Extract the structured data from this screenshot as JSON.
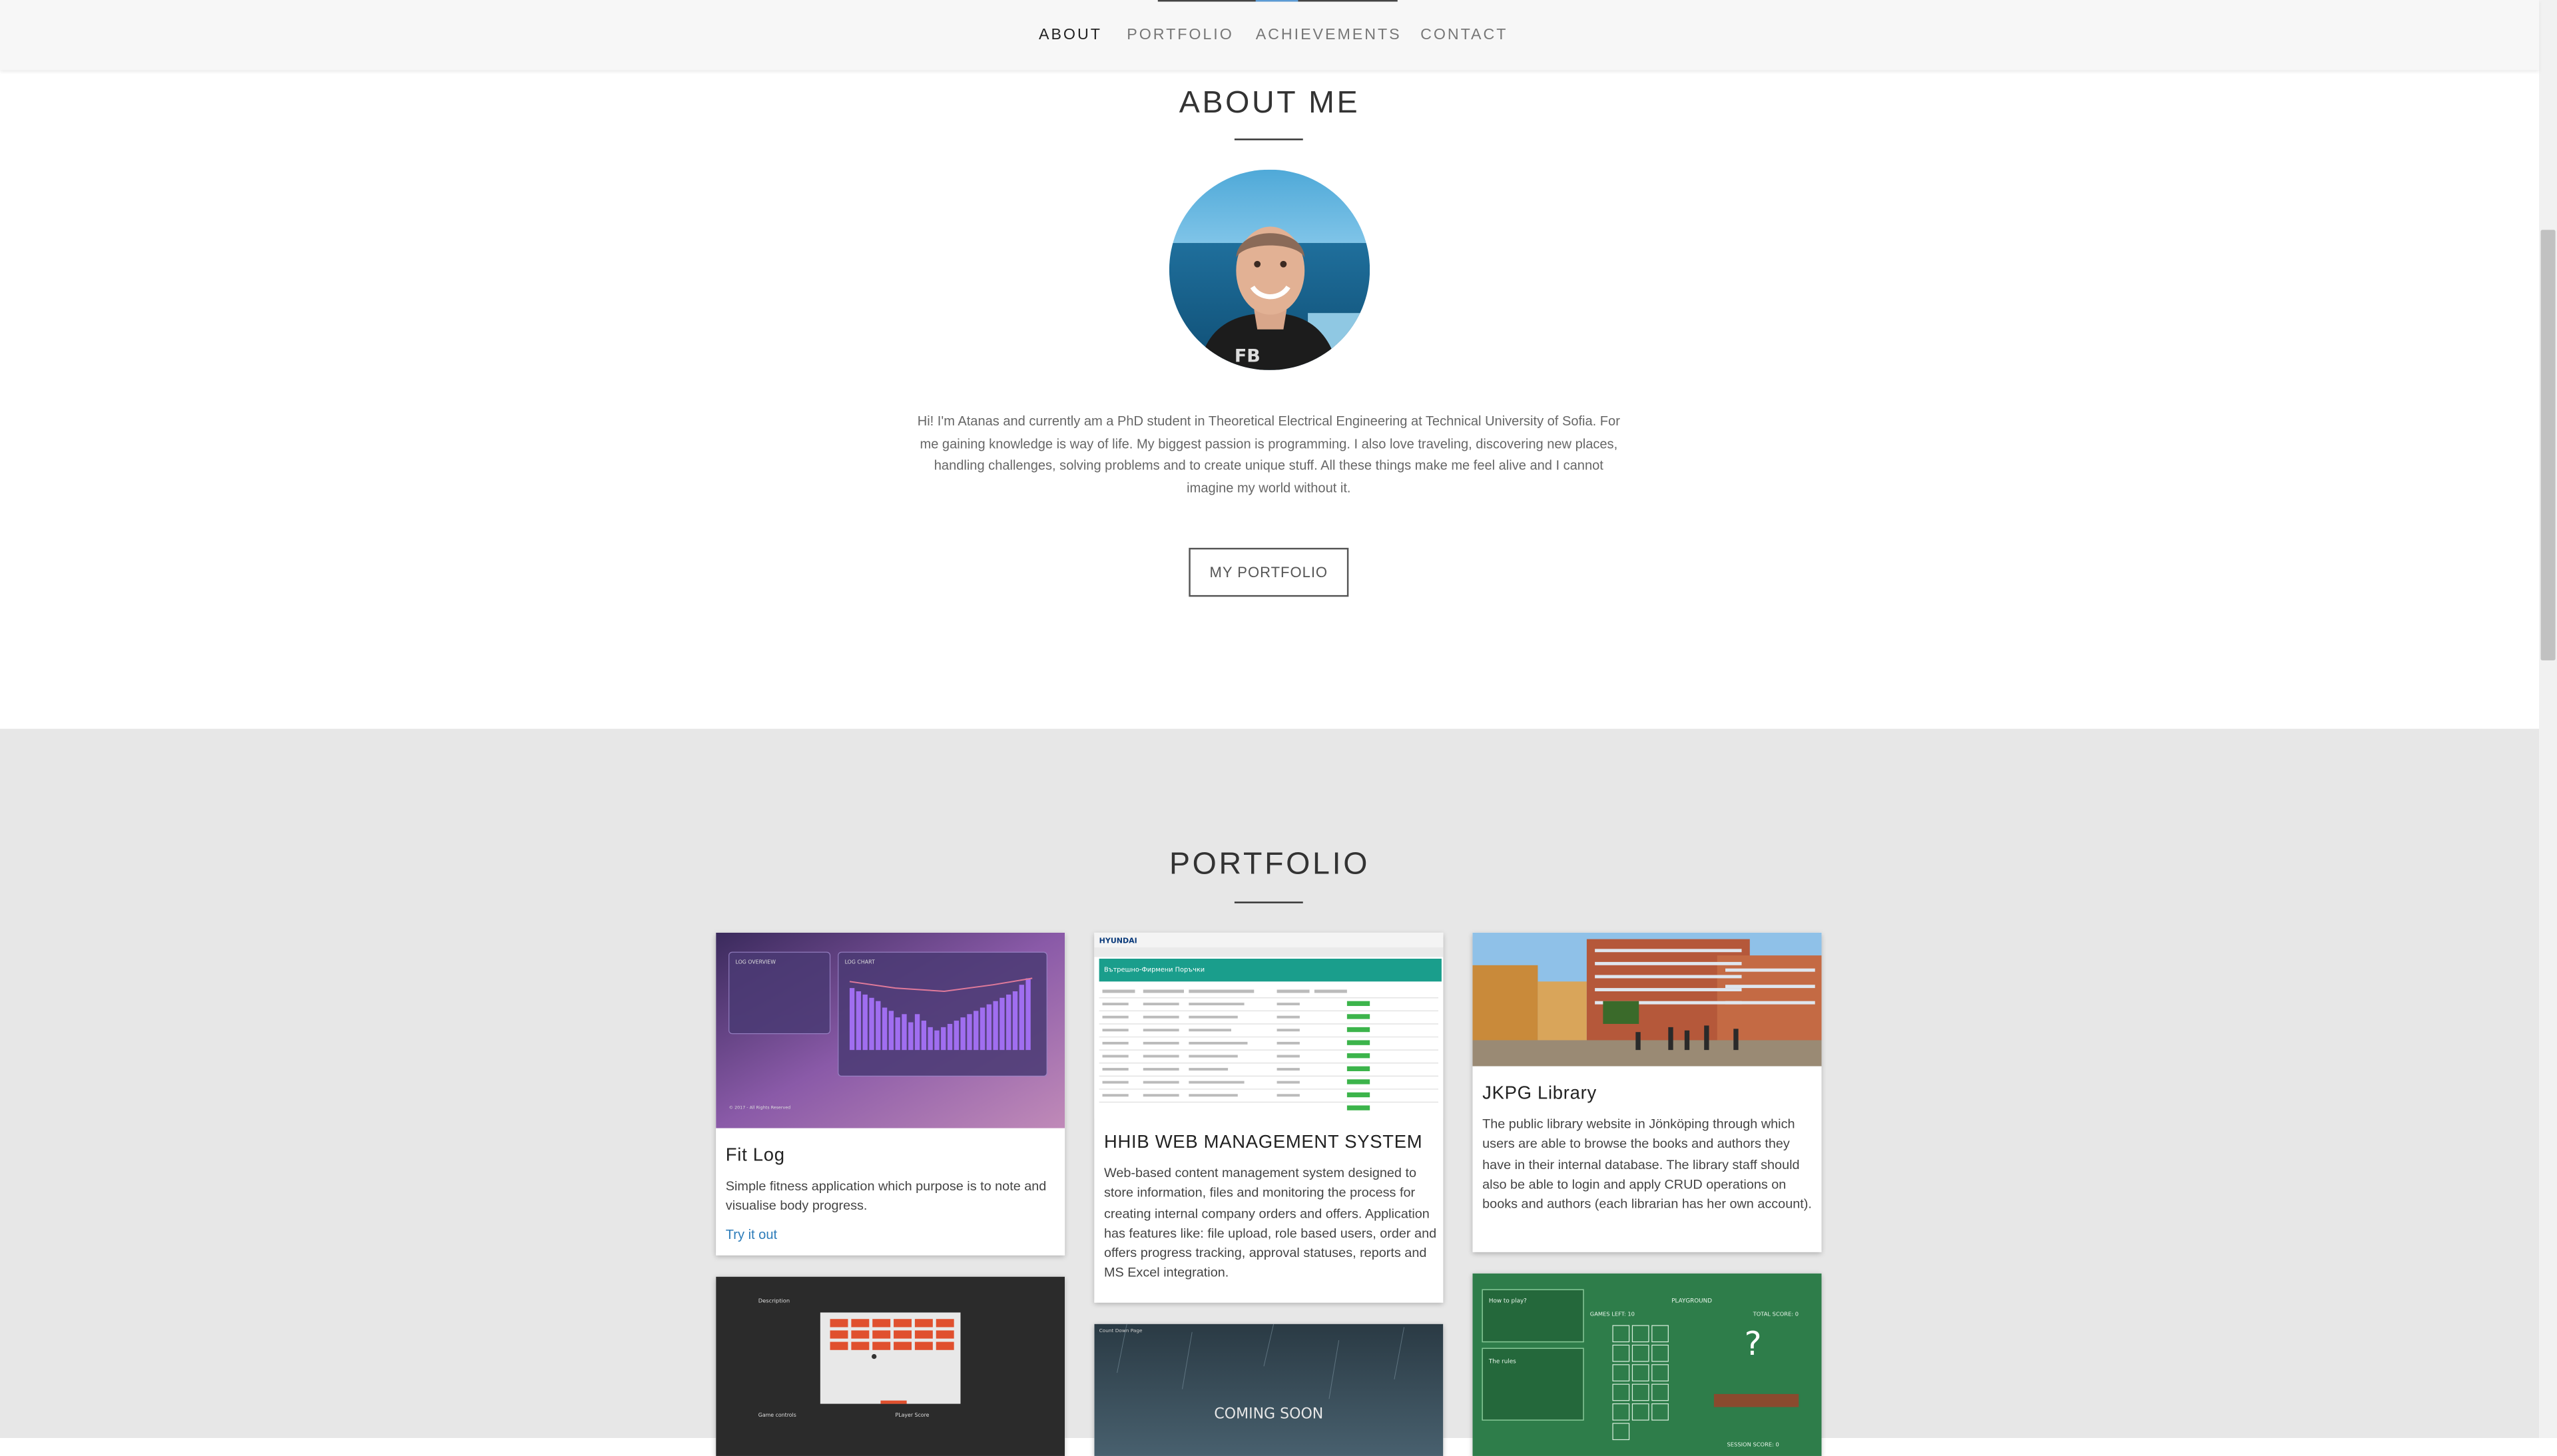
{
  "nav": {
    "items": [
      "ABOUT",
      "PORTFOLIO",
      "ACHIEVEMENTS",
      "CONTACT"
    ],
    "active": "ABOUT"
  },
  "about": {
    "title": "ABOUT ME",
    "bio": "Hi! I'm Atanas and currently am a PhD student in Theoretical Electrical Engineering at Technical University of Sofia. For me gaining knowledge is way of life. My biggest passion is programming. I also love traveling, discovering new places, handling challenges, solving problems and to create unique stuff. All these things make me feel alive and I cannot imagine my world without it.",
    "button_label": "MY PORTFOLIO"
  },
  "portfolio": {
    "title": "PORTFOLIO",
    "cards": [
      {
        "title": "Fit Log",
        "description": "Simple fitness application which purpose is to note and visualise body progress.",
        "link": "Try it out"
      },
      {
        "title": "HHIB WEB MANAGEMENT SYSTEM",
        "description": "Web-based content management system designed to store information, files and monitoring the process for creating internal company orders and offers. Application has features like: file upload, role based users, order and offers progress tracking, approval statuses, reports and MS Excel integration."
      },
      {
        "title": "JKPG Library",
        "description": "The public library website in Jönköping through which users are able to browse the books and authors they have in their internal database. The library staff should also be able to login and apply CRUD operations on books and authors (each librarian has her own account)."
      }
    ],
    "thumbnails": {
      "fitlog": {
        "panel_left": "LOG OVERVIEW",
        "panel_right": "LOG CHART",
        "footer": "© 2017 - All Rights Reserved"
      },
      "hhib": {
        "brand": "HYUNDAI",
        "header": "Вътрешно-Фирмени Поръчки"
      },
      "dark_game": {
        "description": "Description",
        "controls": "Game controls",
        "player_score": "PLayer Score"
      },
      "coming_soon": {
        "text": "COMING SOON",
        "corner": "Count Down Page"
      },
      "green_game": {
        "how_to": "How to play?",
        "rules": "The rules",
        "playground": "PLAYGROUND",
        "games_left": "GAMES LEFT: 10",
        "total_score": "TOTAL SCORE: 0",
        "session_score": "SESSION SCORE: 0",
        "question": "?"
      }
    }
  },
  "colors": {
    "nav_bg": "#f7f7f7",
    "portfolio_bg": "#e7e7e7",
    "link": "#2b7bb9",
    "nav_accent": "#5b9bd5"
  }
}
